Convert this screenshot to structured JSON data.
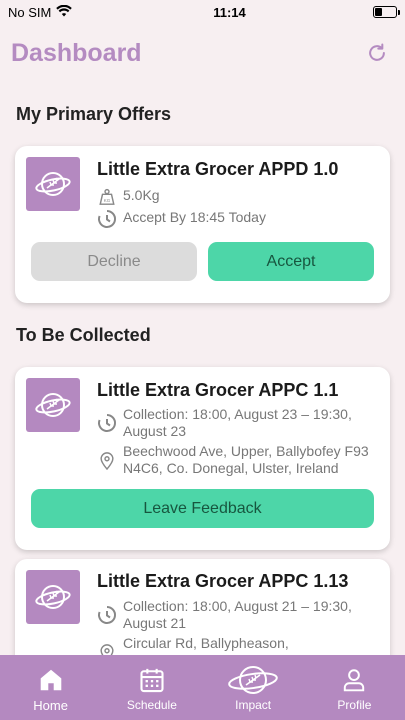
{
  "status_bar": {
    "carrier": "No SIM",
    "time": "11:14",
    "battery_level": 0.35
  },
  "header": {
    "title": "Dashboard",
    "refresh_icon": "refresh-icon"
  },
  "sections": {
    "primary_offers": "My Primary Offers",
    "to_be_collected": "To Be Collected"
  },
  "offer": {
    "title": "Little Extra Grocer APPD 1.0",
    "weight": "5.0Kg",
    "accept_by": "Accept By 18:45 Today",
    "decline_label": "Decline",
    "accept_label": "Accept"
  },
  "collections": [
    {
      "title": "Little Extra Grocer APPC 1.1",
      "collection": "Collection: 18:00, August 23 – 19:30, August 23",
      "address": "Beechwood Ave, Upper, Ballybofey F93 N4C6, Co. Donegal, Ulster, Ireland",
      "feedback_label": "Leave Feedback"
    },
    {
      "title": "Little Extra Grocer APPC 1.13",
      "collection": "Collection: 18:00, August 21 – 19:30, August 21",
      "address": "Circular Rd, Ballypheason,"
    }
  ],
  "tabbar": {
    "items": [
      {
        "label": "Home",
        "icon": "home-icon"
      },
      {
        "label": "Schedule",
        "icon": "calendar-icon"
      },
      {
        "label": "Impact",
        "icon": "planet-leaf-icon"
      },
      {
        "label": "Profile",
        "icon": "person-icon"
      }
    ]
  },
  "colors": {
    "brand_purple": "#b489c0",
    "accent_green": "#4dd6a8",
    "background": "#f7eff1"
  }
}
